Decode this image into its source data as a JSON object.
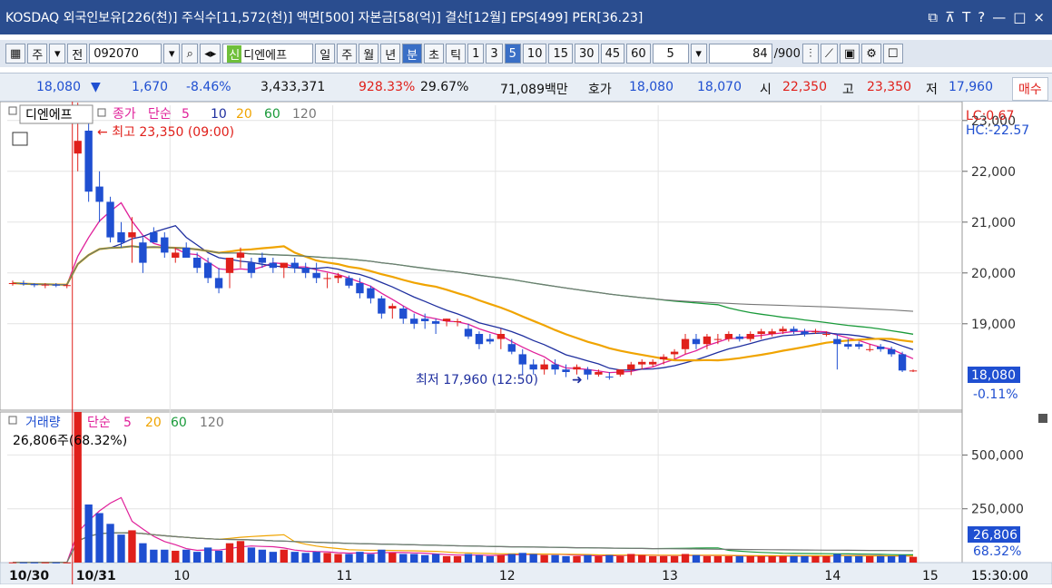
{
  "window": {
    "title": "KOSDAQ 외국인보유[226(천)] 주식수[11,572(천)] 액면[500] 자본금[58(억)] 결산[12월] EPS[499] PER[36.23]"
  },
  "toolbar": {
    "type_label": "주",
    "prefix": "전",
    "code": "092070",
    "name_tag": "신",
    "name": "디엔에프",
    "period_tabs": [
      "일",
      "주",
      "월",
      "년",
      "분",
      "초",
      "틱"
    ],
    "selected_period": "분",
    "intervals": [
      "1",
      "3",
      "5",
      "10",
      "15",
      "30",
      "45",
      "60"
    ],
    "selected_interval": "5",
    "interval_value": "5",
    "count": "84",
    "count_max": "/900"
  },
  "quote": {
    "price": "18,080",
    "arrow": "▼",
    "change": "1,670",
    "change_rate": "-8.46%",
    "volume": "3,433,371",
    "volume_rate": "928.33%",
    "turnover": "29.67%",
    "amount": "71,089백만",
    "ask_label": "호가",
    "ask": "18,080",
    "bid": "18,070",
    "open_label": "시",
    "open": "22,350",
    "high_label": "고",
    "high": "23,350",
    "low_label": "저",
    "low": "17,960",
    "trade_button": "매수"
  },
  "price_legend": {
    "name": "디엔에프",
    "close_label": "종가",
    "ma_type": "단순",
    "periods": [
      "5",
      "10",
      "20",
      "60",
      "120"
    ],
    "high_annotation": "최고 23,350 (09:00)",
    "low_annotation": "최저 17,960 (12:50)",
    "lc": "LC:0.67",
    "hc": "HC:-22.57",
    "last_price": "18,080",
    "last_change": "-0.11%"
  },
  "volume_legend": {
    "label": "거래량",
    "ma_type": "단순",
    "periods": [
      "5",
      "20",
      "60",
      "120"
    ],
    "info": "26,806주(68.32%)",
    "last_volume": "26,806",
    "last_rate": "68.32%"
  },
  "x_axis": {
    "labels": [
      "10/30",
      "10/31",
      "10",
      "11",
      "12",
      "13",
      "14",
      "15"
    ],
    "time": "15:30:00"
  },
  "chart_data": {
    "type": "candlestick",
    "ylim": [
      17300,
      23300
    ],
    "price_ticks": [
      23000,
      22000,
      21000,
      20000,
      19000
    ],
    "volume_ylim": [
      0,
      700000
    ],
    "volume_ticks": [
      500000,
      250000
    ],
    "colors": {
      "up": "#e0201b",
      "down": "#1f4fd1",
      "ma5": "#e0209a",
      "ma10": "#1f2f9f",
      "ma20": "#f0a400",
      "ma60": "#1a9a3a",
      "ma120": "#777777"
    },
    "candles": [
      [
        19800,
        19850,
        19750,
        19800
      ],
      [
        19800,
        19850,
        19750,
        19780
      ],
      [
        19780,
        19800,
        19720,
        19760
      ],
      [
        19760,
        19800,
        19700,
        19770
      ],
      [
        19770,
        19800,
        19720,
        19750
      ],
      [
        19750,
        19780,
        19700,
        19760
      ],
      [
        22350,
        23350,
        22000,
        22600
      ],
      [
        22800,
        23000,
        21400,
        21600
      ],
      [
        21700,
        22000,
        21000,
        21400
      ],
      [
        21400,
        21500,
        20600,
        20700
      ],
      [
        20800,
        21000,
        20500,
        20600
      ],
      [
        20700,
        21100,
        20200,
        20800
      ],
      [
        20600,
        20700,
        20000,
        20200
      ],
      [
        20800,
        20900,
        20600,
        20600
      ],
      [
        20700,
        20800,
        20300,
        20400
      ],
      [
        20300,
        20500,
        20200,
        20400
      ],
      [
        20500,
        20600,
        20300,
        20300
      ],
      [
        20300,
        20400,
        20000,
        20100
      ],
      [
        20200,
        20300,
        19800,
        19900
      ],
      [
        19900,
        20100,
        19600,
        19700
      ],
      [
        20000,
        20100,
        19700,
        20300
      ],
      [
        20300,
        20500,
        20100,
        20400
      ],
      [
        20200,
        20300,
        19900,
        20000
      ],
      [
        20300,
        20400,
        20100,
        20200
      ],
      [
        20200,
        20300,
        20000,
        20100
      ],
      [
        20100,
        20200,
        19900,
        20200
      ],
      [
        20200,
        20300,
        20000,
        20100
      ],
      [
        20100,
        20200,
        19900,
        20000
      ],
      [
        20000,
        20200,
        19800,
        19900
      ],
      [
        19900,
        20000,
        19700,
        19900
      ],
      [
        19900,
        20000,
        19800,
        19950
      ],
      [
        19900,
        19950,
        19700,
        19750
      ],
      [
        19800,
        19900,
        19500,
        19600
      ],
      [
        19700,
        19750,
        19400,
        19500
      ],
      [
        19500,
        19550,
        19100,
        19200
      ],
      [
        19300,
        19400,
        19100,
        19350
      ],
      [
        19300,
        19350,
        19000,
        19100
      ],
      [
        19100,
        19200,
        18900,
        19000
      ],
      [
        19100,
        19200,
        18900,
        19050
      ],
      [
        19050,
        19100,
        18800,
        19000
      ],
      [
        19050,
        19100,
        18950,
        19100
      ],
      [
        19050,
        19100,
        18950,
        19050
      ],
      [
        18900,
        19000,
        18700,
        18750
      ],
      [
        18800,
        18850,
        18500,
        18600
      ],
      [
        18700,
        18800,
        18600,
        18650
      ],
      [
        18700,
        18900,
        18500,
        18800
      ],
      [
        18600,
        18700,
        18400,
        18450
      ],
      [
        18400,
        18500,
        18000,
        18200
      ],
      [
        18200,
        18300,
        18000,
        18100
      ],
      [
        18100,
        18300,
        18000,
        18200
      ],
      [
        18200,
        18300,
        18000,
        18100
      ],
      [
        18100,
        18200,
        17950,
        18050
      ],
      [
        18100,
        18200,
        18000,
        18150
      ],
      [
        18100,
        18150,
        17900,
        18000
      ],
      [
        18000,
        18100,
        17960,
        18050
      ],
      [
        17960,
        18050,
        17900,
        17950
      ],
      [
        18000,
        18100,
        17960,
        18100
      ],
      [
        18100,
        18250,
        17990,
        18200
      ],
      [
        18200,
        18300,
        18100,
        18250
      ],
      [
        18200,
        18300,
        18150,
        18250
      ],
      [
        18300,
        18400,
        18200,
        18350
      ],
      [
        18400,
        18500,
        18300,
        18450
      ],
      [
        18500,
        18800,
        18400,
        18700
      ],
      [
        18700,
        18800,
        18500,
        18600
      ],
      [
        18600,
        18800,
        18500,
        18750
      ],
      [
        18700,
        18800,
        18600,
        18700
      ],
      [
        18700,
        18850,
        18650,
        18800
      ],
      [
        18750,
        18800,
        18650,
        18700
      ],
      [
        18700,
        18850,
        18650,
        18800
      ],
      [
        18800,
        18900,
        18700,
        18850
      ],
      [
        18800,
        18900,
        18750,
        18850
      ],
      [
        18850,
        18950,
        18800,
        18900
      ],
      [
        18900,
        18950,
        18800,
        18850
      ],
      [
        18850,
        18900,
        18750,
        18800
      ],
      [
        18850,
        18900,
        18800,
        18850
      ],
      [
        18800,
        18850,
        18750,
        18800
      ],
      [
        18700,
        18800,
        18100,
        18600
      ],
      [
        18600,
        18700,
        18500,
        18550
      ],
      [
        18600,
        18650,
        18500,
        18550
      ],
      [
        18500,
        18600,
        18450,
        18500
      ],
      [
        18550,
        18600,
        18450,
        18500
      ],
      [
        18500,
        18550,
        18350,
        18400
      ],
      [
        18400,
        18450,
        18050,
        18080
      ],
      [
        18080,
        18100,
        18050,
        18080
      ]
    ],
    "volumes": [
      1000,
      900,
      800,
      900,
      700,
      800,
      700000,
      270000,
      230000,
      180000,
      130000,
      150000,
      90000,
      60000,
      60000,
      55000,
      60000,
      50000,
      70000,
      55000,
      90000,
      100000,
      70000,
      60000,
      50000,
      60000,
      50000,
      45000,
      50000,
      45000,
      40000,
      40000,
      50000,
      40000,
      60000,
      45000,
      40000,
      40000,
      35000,
      40000,
      30000,
      30000,
      40000,
      35000,
      30000,
      35000,
      40000,
      45000,
      40000,
      35000,
      35000,
      30000,
      30000,
      35000,
      30000,
      35000,
      30000,
      40000,
      35000,
      30000,
      30000,
      30000,
      40000,
      35000,
      30000,
      30000,
      30000,
      30000,
      30000,
      30000,
      30000,
      30000,
      30000,
      30000,
      30000,
      30000,
      40000,
      30000,
      30000,
      30000,
      30000,
      30000,
      35000,
      26806
    ],
    "x_labels": [
      "10/30",
      "10/31",
      "10",
      "11",
      "12",
      "13",
      "14",
      "15"
    ]
  }
}
